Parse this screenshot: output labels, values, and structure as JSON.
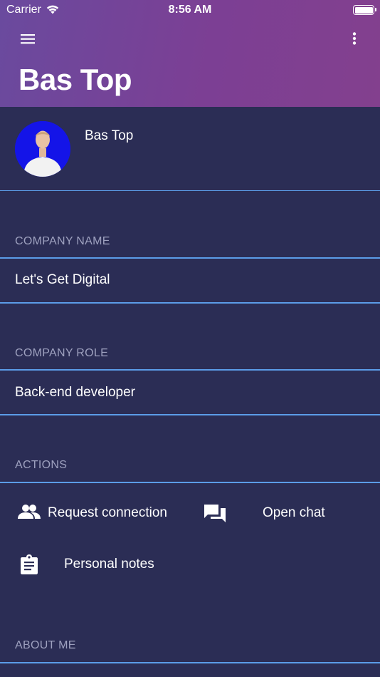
{
  "status_bar": {
    "carrier": "Carrier",
    "time": "8:56 AM"
  },
  "header": {
    "title": "Bas Top",
    "menu_icon": "hamburger-menu-icon",
    "more_icon": "more-vertical-icon"
  },
  "profile": {
    "name": "Bas Top",
    "avatar_bg": "#1414e8"
  },
  "company_name": {
    "label": "COMPANY NAME",
    "value": "Let's Get Digital"
  },
  "company_role": {
    "label": "COMPANY ROLE",
    "value": "Back-end developer"
  },
  "actions": {
    "label": "ACTIONS",
    "items": [
      {
        "label": "Request connection",
        "icon": "people-icon"
      },
      {
        "label": "Open chat",
        "icon": "chat-icon"
      },
      {
        "label": "Personal notes",
        "icon": "clipboard-icon"
      }
    ]
  },
  "about": {
    "label": "ABOUT ME"
  },
  "colors": {
    "background": "#2b2d55",
    "divider": "#5b9ce8",
    "section_label": "#9ea1bf",
    "header_gradient_start": "#6a4a9e",
    "header_gradient_end": "#83408e"
  }
}
